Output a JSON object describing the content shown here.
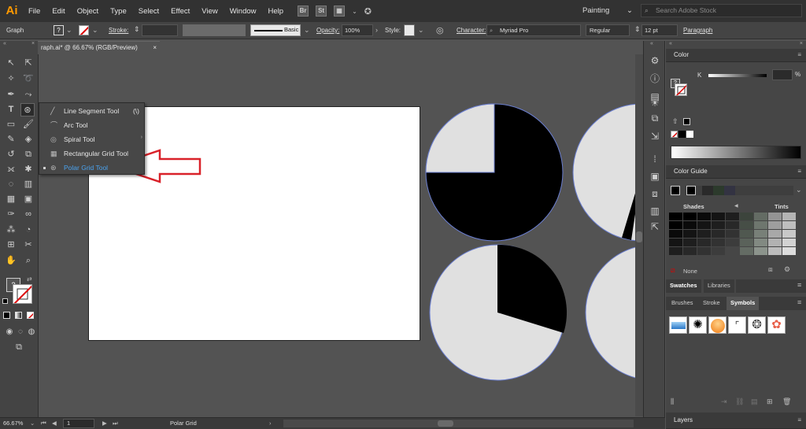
{
  "menu": {
    "logo": "Ai",
    "items": [
      "File",
      "Edit",
      "Object",
      "Type",
      "Select",
      "Effect",
      "View",
      "Window",
      "Help"
    ],
    "bridge_labels": [
      "Br",
      "St"
    ],
    "workspace": "Painting",
    "search_placeholder": "Search Adobe Stock"
  },
  "control": {
    "mode_label": "Graph",
    "stroke_label": "Stroke:",
    "stroke_style": "Basic",
    "opacity_label": "Opacity:",
    "opacity_value": "100%",
    "style_label": "Style:",
    "character_label": "Character:",
    "font_name": "Myriad Pro",
    "font_style": "Regular",
    "font_size": "12 pt",
    "paragraph_label": "Paragraph"
  },
  "document": {
    "tab_title": "raph.ai* @ 66.67% (RGB/Preview)",
    "close": "×"
  },
  "flyout": {
    "items": [
      {
        "label": "Line Segment Tool",
        "shortcut": "(\\)"
      },
      {
        "label": "Arc Tool",
        "shortcut": ""
      },
      {
        "label": "Spiral Tool",
        "shortcut": ""
      },
      {
        "label": "Rectangular Grid Tool",
        "shortcut": ""
      },
      {
        "label": "Polar Grid Tool",
        "shortcut": ""
      }
    ],
    "selected_index": 4,
    "arrow_color": "#d9222a"
  },
  "status": {
    "zoom": "66.67%",
    "page": "1",
    "tool_name": "Polar Grid"
  },
  "panels": {
    "color_title": "Color",
    "color_channel": "K",
    "color_percent": "%",
    "guide_title": "Color Guide",
    "shades_label": "Shades",
    "tints_label": "Tints",
    "none_label": "None",
    "swatches_tab": "Swatches",
    "libraries_tab": "Libraries",
    "brushes_tab": "Brushes",
    "stroke_tab": "Stroke",
    "symbols_tab": "Symbols",
    "layers_title": "Layers"
  },
  "colors": {
    "highlight": "#4aa3f0",
    "logo": "#ff9a00",
    "pie_light": "#e0e0e0",
    "pie_dark": "#000000",
    "pie_outline": "#6a7ed0"
  }
}
